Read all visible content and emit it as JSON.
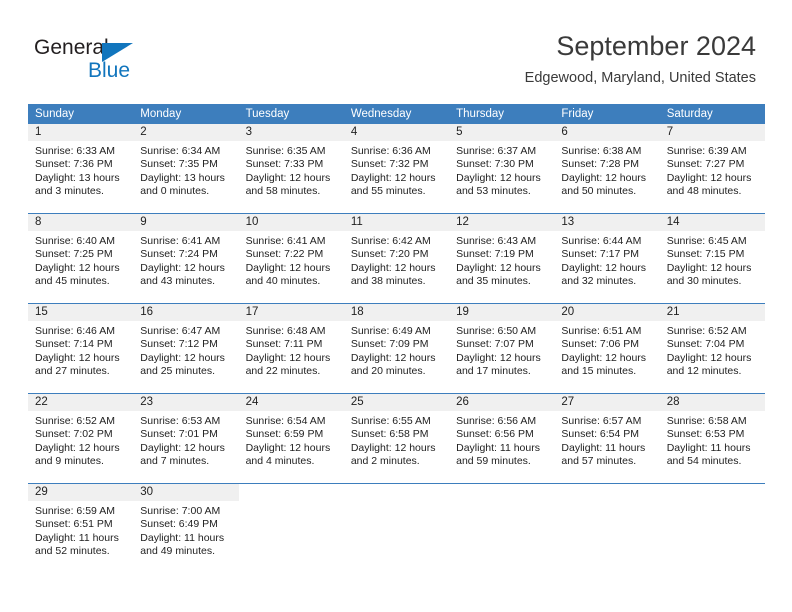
{
  "brand": {
    "name_part1": "General",
    "name_part2": "Blue",
    "logo_icon": "triangle-logo-icon",
    "colors": {
      "dark": "#231f20",
      "blue": "#1175bd"
    }
  },
  "header": {
    "title": "September 2024",
    "subtitle": "Edgewood, Maryland, United States"
  },
  "calendar": {
    "accent_color": "#3d7ebd",
    "daynum_band_color": "#f0f0f0",
    "weekdays": [
      "Sunday",
      "Monday",
      "Tuesday",
      "Wednesday",
      "Thursday",
      "Friday",
      "Saturday"
    ],
    "weeks": [
      [
        {
          "day": "1",
          "sunrise": "Sunrise: 6:33 AM",
          "sunset": "Sunset: 7:36 PM",
          "daylight": "Daylight: 13 hours and 3 minutes."
        },
        {
          "day": "2",
          "sunrise": "Sunrise: 6:34 AM",
          "sunset": "Sunset: 7:35 PM",
          "daylight": "Daylight: 13 hours and 0 minutes."
        },
        {
          "day": "3",
          "sunrise": "Sunrise: 6:35 AM",
          "sunset": "Sunset: 7:33 PM",
          "daylight": "Daylight: 12 hours and 58 minutes."
        },
        {
          "day": "4",
          "sunrise": "Sunrise: 6:36 AM",
          "sunset": "Sunset: 7:32 PM",
          "daylight": "Daylight: 12 hours and 55 minutes."
        },
        {
          "day": "5",
          "sunrise": "Sunrise: 6:37 AM",
          "sunset": "Sunset: 7:30 PM",
          "daylight": "Daylight: 12 hours and 53 minutes."
        },
        {
          "day": "6",
          "sunrise": "Sunrise: 6:38 AM",
          "sunset": "Sunset: 7:28 PM",
          "daylight": "Daylight: 12 hours and 50 minutes."
        },
        {
          "day": "7",
          "sunrise": "Sunrise: 6:39 AM",
          "sunset": "Sunset: 7:27 PM",
          "daylight": "Daylight: 12 hours and 48 minutes."
        }
      ],
      [
        {
          "day": "8",
          "sunrise": "Sunrise: 6:40 AM",
          "sunset": "Sunset: 7:25 PM",
          "daylight": "Daylight: 12 hours and 45 minutes."
        },
        {
          "day": "9",
          "sunrise": "Sunrise: 6:41 AM",
          "sunset": "Sunset: 7:24 PM",
          "daylight": "Daylight: 12 hours and 43 minutes."
        },
        {
          "day": "10",
          "sunrise": "Sunrise: 6:41 AM",
          "sunset": "Sunset: 7:22 PM",
          "daylight": "Daylight: 12 hours and 40 minutes."
        },
        {
          "day": "11",
          "sunrise": "Sunrise: 6:42 AM",
          "sunset": "Sunset: 7:20 PM",
          "daylight": "Daylight: 12 hours and 38 minutes."
        },
        {
          "day": "12",
          "sunrise": "Sunrise: 6:43 AM",
          "sunset": "Sunset: 7:19 PM",
          "daylight": "Daylight: 12 hours and 35 minutes."
        },
        {
          "day": "13",
          "sunrise": "Sunrise: 6:44 AM",
          "sunset": "Sunset: 7:17 PM",
          "daylight": "Daylight: 12 hours and 32 minutes."
        },
        {
          "day": "14",
          "sunrise": "Sunrise: 6:45 AM",
          "sunset": "Sunset: 7:15 PM",
          "daylight": "Daylight: 12 hours and 30 minutes."
        }
      ],
      [
        {
          "day": "15",
          "sunrise": "Sunrise: 6:46 AM",
          "sunset": "Sunset: 7:14 PM",
          "daylight": "Daylight: 12 hours and 27 minutes."
        },
        {
          "day": "16",
          "sunrise": "Sunrise: 6:47 AM",
          "sunset": "Sunset: 7:12 PM",
          "daylight": "Daylight: 12 hours and 25 minutes."
        },
        {
          "day": "17",
          "sunrise": "Sunrise: 6:48 AM",
          "sunset": "Sunset: 7:11 PM",
          "daylight": "Daylight: 12 hours and 22 minutes."
        },
        {
          "day": "18",
          "sunrise": "Sunrise: 6:49 AM",
          "sunset": "Sunset: 7:09 PM",
          "daylight": "Daylight: 12 hours and 20 minutes."
        },
        {
          "day": "19",
          "sunrise": "Sunrise: 6:50 AM",
          "sunset": "Sunset: 7:07 PM",
          "daylight": "Daylight: 12 hours and 17 minutes."
        },
        {
          "day": "20",
          "sunrise": "Sunrise: 6:51 AM",
          "sunset": "Sunset: 7:06 PM",
          "daylight": "Daylight: 12 hours and 15 minutes."
        },
        {
          "day": "21",
          "sunrise": "Sunrise: 6:52 AM",
          "sunset": "Sunset: 7:04 PM",
          "daylight": "Daylight: 12 hours and 12 minutes."
        }
      ],
      [
        {
          "day": "22",
          "sunrise": "Sunrise: 6:52 AM",
          "sunset": "Sunset: 7:02 PM",
          "daylight": "Daylight: 12 hours and 9 minutes."
        },
        {
          "day": "23",
          "sunrise": "Sunrise: 6:53 AM",
          "sunset": "Sunset: 7:01 PM",
          "daylight": "Daylight: 12 hours and 7 minutes."
        },
        {
          "day": "24",
          "sunrise": "Sunrise: 6:54 AM",
          "sunset": "Sunset: 6:59 PM",
          "daylight": "Daylight: 12 hours and 4 minutes."
        },
        {
          "day": "25",
          "sunrise": "Sunrise: 6:55 AM",
          "sunset": "Sunset: 6:58 PM",
          "daylight": "Daylight: 12 hours and 2 minutes."
        },
        {
          "day": "26",
          "sunrise": "Sunrise: 6:56 AM",
          "sunset": "Sunset: 6:56 PM",
          "daylight": "Daylight: 11 hours and 59 minutes."
        },
        {
          "day": "27",
          "sunrise": "Sunrise: 6:57 AM",
          "sunset": "Sunset: 6:54 PM",
          "daylight": "Daylight: 11 hours and 57 minutes."
        },
        {
          "day": "28",
          "sunrise": "Sunrise: 6:58 AM",
          "sunset": "Sunset: 6:53 PM",
          "daylight": "Daylight: 11 hours and 54 minutes."
        }
      ],
      [
        {
          "day": "29",
          "sunrise": "Sunrise: 6:59 AM",
          "sunset": "Sunset: 6:51 PM",
          "daylight": "Daylight: 11 hours and 52 minutes."
        },
        {
          "day": "30",
          "sunrise": "Sunrise: 7:00 AM",
          "sunset": "Sunset: 6:49 PM",
          "daylight": "Daylight: 11 hours and 49 minutes."
        },
        {
          "day": "",
          "sunrise": "",
          "sunset": "",
          "daylight": ""
        },
        {
          "day": "",
          "sunrise": "",
          "sunset": "",
          "daylight": ""
        },
        {
          "day": "",
          "sunrise": "",
          "sunset": "",
          "daylight": ""
        },
        {
          "day": "",
          "sunrise": "",
          "sunset": "",
          "daylight": ""
        },
        {
          "day": "",
          "sunrise": "",
          "sunset": "",
          "daylight": ""
        }
      ]
    ]
  }
}
